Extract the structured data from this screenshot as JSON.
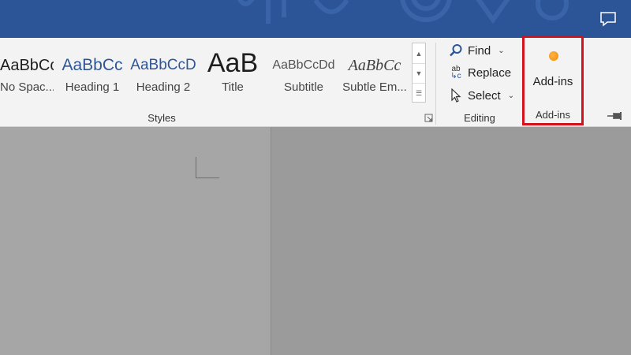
{
  "styles_group": {
    "label": "Styles",
    "items": [
      {
        "preview": "AaBbCc",
        "label": "No Spac..."
      },
      {
        "preview": "AaBbCc",
        "label": "Heading 1"
      },
      {
        "preview": "AaBbCcD",
        "label": "Heading 2"
      },
      {
        "preview": "AaB",
        "label": "Title"
      },
      {
        "preview": "AaBbCcDd",
        "label": "Subtitle"
      },
      {
        "preview": "AaBbCc",
        "label": "Subtle Em..."
      }
    ]
  },
  "editing_group": {
    "label": "Editing",
    "find_label": "Find",
    "replace_label": "Replace",
    "select_label": "Select",
    "replace_icon_text": "ab"
  },
  "addins_group": {
    "button_label": "Add-ins",
    "label": "Add-ins"
  },
  "colors": {
    "titlebar": "#2b5597",
    "highlight": "#d3121d",
    "addin_icon": "#f28a00"
  }
}
